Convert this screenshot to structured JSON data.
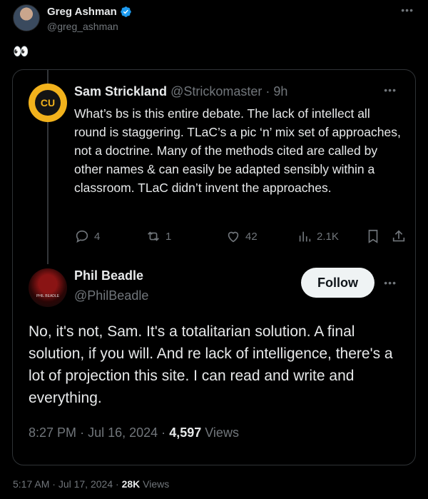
{
  "outer_tweet": {
    "author_name": "Greg Ashman",
    "author_handle": "@greg_ashman",
    "more_icon": "more-horizontal-icon",
    "body": "👀",
    "time": "5:17 AM",
    "date": "Jul 17, 2024",
    "views_count": "28K",
    "views_label": "Views",
    "verified_color": "#1d9bf0"
  },
  "sam_tweet": {
    "author_name": "Sam Strickland",
    "author_handle": "@Strickomaster",
    "age": "9h",
    "avatar_text": "CU",
    "text": "What’s bs is this entire debate. The lack of intellect all round is staggering. TLaC’s a pic ‘n’ mix set of approaches, not a doctrine. Many of the methods cited are called by other names & can easily be adapted sensibly within a classroom. TLaC didn’t invent the approaches.",
    "actions": {
      "replies": "4",
      "reposts": "1",
      "likes": "42",
      "views": "2.1K"
    }
  },
  "phil_tweet": {
    "author_name": "Phil Beadle",
    "author_handle": "@PhilBeadle",
    "avatar_text": "PHIL BEADLE",
    "follow_label": "Follow",
    "text": "No, it's not, Sam. It's a totalitarian solution. A final solution, if you will. And re lack of intelligence, there's a lot of projection this site. I can read and write and everything.",
    "time": "8:27 PM",
    "date": "Jul 16, 2024",
    "views_count": "4,597",
    "views_label": "Views"
  },
  "separator": "·"
}
